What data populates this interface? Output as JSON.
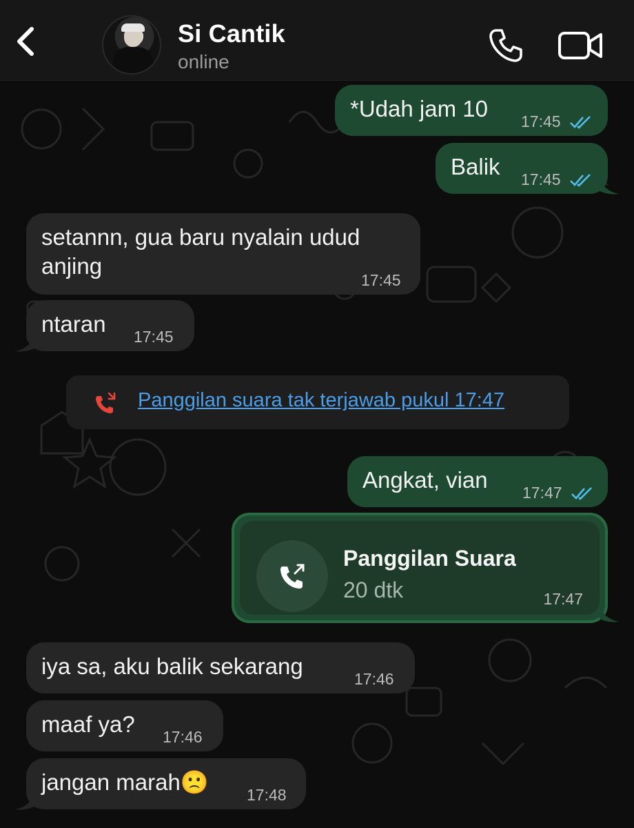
{
  "header": {
    "contact_name": "Si Cantik",
    "status": "online",
    "icons": [
      "chevron-left-icon",
      "phone-icon",
      "video-camera-icon"
    ]
  },
  "messages": [
    {
      "dir": "out",
      "text": "*Udah jam 10",
      "time": "17:45",
      "read": true
    },
    {
      "dir": "out",
      "text": "Balik",
      "time": "17:45",
      "read": true
    },
    {
      "dir": "in",
      "text": "setannn, gua baru nyalain udud anjing",
      "time": "17:45"
    },
    {
      "dir": "in",
      "text": "ntaran",
      "time": "17:45"
    },
    {
      "dir": "out",
      "text": "Angkat, vian",
      "time": "17:47",
      "read": true
    },
    {
      "dir": "in",
      "text": "iya sa, aku balik sekarang",
      "time": "17:46"
    },
    {
      "dir": "in",
      "text": "maaf ya?",
      "time": "17:46"
    },
    {
      "dir": "in",
      "text": "jangan marah🙁",
      "time": "17:48"
    }
  ],
  "system_notice": {
    "text": "Panggilan suara tak terjawab pukul 17:47",
    "icon": "missed-call-icon"
  },
  "call_card": {
    "title": "Panggilan Suara",
    "duration": "20 dtk",
    "time": "17:47",
    "icon": "outgoing-call-icon"
  },
  "colors": {
    "outgoing_bubble": "#1d4a30",
    "incoming_bubble": "#262626",
    "link_blue": "#4a9fe8",
    "read_ticks": "#53bdeb",
    "missed_call_red": "#e5473b"
  }
}
